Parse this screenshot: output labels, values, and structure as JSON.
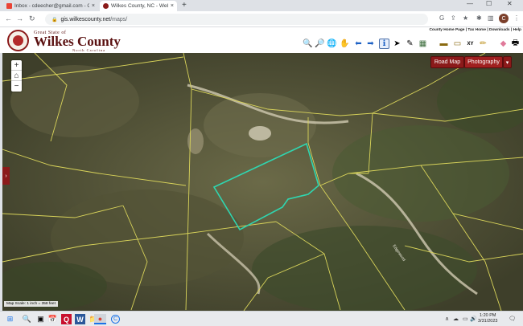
{
  "browser": {
    "tabs": [
      {
        "title": "Inbox - cdeecher@gmail.com - Gm",
        "close": "×"
      },
      {
        "title": "Wilkes County, NC - Web Map Vi",
        "close": "×"
      }
    ],
    "new_tab": "+",
    "window_controls": [
      "—",
      "☐",
      "✕"
    ],
    "url_host": "gis.wilkescounty.net",
    "url_path": "/maps/",
    "avatar_letter": "C"
  },
  "header": {
    "logo_top": "Great State of",
    "logo_main": "Wilkes County",
    "logo_sub": "North Carolina",
    "links": "County Home Page | Tax Home | Downloads | Help"
  },
  "toolbar": {
    "tools": [
      {
        "name": "zoom-in-icon",
        "glyph": "🔍"
      },
      {
        "name": "zoom-out-icon",
        "glyph": "🔎"
      },
      {
        "name": "globe-icon",
        "glyph": "🌐"
      },
      {
        "name": "pan-hand-icon",
        "glyph": "✋"
      },
      {
        "name": "back-arrow-icon",
        "glyph": "⬅"
      },
      {
        "name": "forward-arrow-icon",
        "glyph": "➡"
      },
      {
        "name": "identify-icon",
        "glyph": "ℹ"
      },
      {
        "name": "select-pointer-icon",
        "glyph": "➤"
      },
      {
        "name": "measure-icon",
        "glyph": "✎"
      },
      {
        "name": "layers-map-icon",
        "glyph": "▦"
      }
    ],
    "tools_right": [
      {
        "name": "ruler-icon",
        "glyph": "▬"
      },
      {
        "name": "buffer-icon",
        "glyph": "▭"
      },
      {
        "name": "xy-coordinate-icon",
        "glyph": "XY"
      },
      {
        "name": "pencil-icon",
        "glyph": "✏"
      },
      {
        "name": "eraser-icon",
        "glyph": "◆"
      },
      {
        "name": "print-icon",
        "glyph": "🖶"
      }
    ]
  },
  "map": {
    "zoom_in": "+",
    "home": "⌂",
    "zoom_out": "−",
    "road_map_button": "Road Map",
    "photography_button": "Photography",
    "basemap_dropdown": "▾",
    "side_panel_toggle": "›",
    "scale_text": "Map Scale: 1 inch = 358 feet",
    "road_label": "Edgewood",
    "parcel_outline_color": "#d9d45a",
    "selected_parcel_color": "#2fd6b0"
  },
  "taskbar": {
    "icons": [
      "⊞",
      "🔍",
      "▣",
      "📅",
      "Q",
      "W",
      "📁",
      "●",
      "C"
    ],
    "tray": [
      "∧",
      "☁",
      "▭",
      "🔊"
    ],
    "time": "1:20 PM",
    "date": "3/31/2023",
    "notifications": "🗨"
  }
}
